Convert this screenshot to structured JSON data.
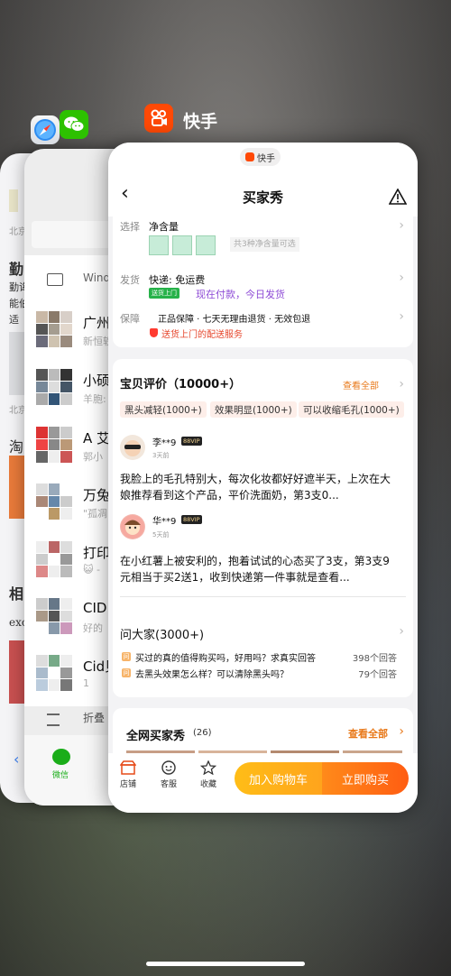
{
  "switcher": {
    "kuaishou_label": "快手"
  },
  "safari_card": {
    "lines": [
      "北京",
      "勤",
      "勤诲",
      "能伯",
      "适",
      "北京",
      "淘",
      "相",
      "exc"
    ],
    "bottom_icon": "chevron-left"
  },
  "wechat_card": {
    "header_row": "Wind",
    "rows": [
      {
        "title": "广州",
        "sub": "新恒轶"
      },
      {
        "title": "小硕",
        "sub": "羊胞:"
      },
      {
        "title": "A 艾",
        "sub": "郭小"
      },
      {
        "title": "万兔",
        "sub": "\"孤凋"
      },
      {
        "title": "打印",
        "sub": "😺 -"
      },
      {
        "title": "CID",
        "sub": "好的"
      },
      {
        "title": "Cid贝",
        "sub": "1"
      }
    ],
    "folded_label": "折叠",
    "tab_label": "微信"
  },
  "kuaishou": {
    "top_badge": "快手",
    "page_title": "买家秀",
    "spec": {
      "select_label": "选择",
      "select_value": "净含量",
      "select_hint": "共3种净含量可选",
      "ship_label": "发货",
      "ship_value": "快递: 免运费",
      "ship_badge": "送货上门",
      "ship_note": "现在付款，今日发货",
      "guarantee_label": "保障",
      "guarantee_value": "正品保障 · 七天无理由退货 · 无效包退",
      "guarantee_note": "送货上门的配送服务"
    },
    "reviews": {
      "title": "宝贝评价（10000+）",
      "view_all": "查看全部",
      "tags": [
        "黑头减轻(1000+)",
        "效果明显(1000+)",
        "可以收缩毛孔(1000+)"
      ],
      "items": [
        {
          "user": "李**9",
          "vip": "88VIP",
          "time": "3天前",
          "text": "我脸上的毛孔特别大，每次化妆都好好遮半天，上次在大娘推荐看到这个产品，平价洗面奶，第3支0..."
        },
        {
          "user": "华**9",
          "vip": "88VIP",
          "time": "5天前",
          "text": "在小红薯上被安利的，抱着试试的心态买了3支，第3支9元相当于买2送1，收到快递第一件事就是查看..."
        }
      ]
    },
    "qa": {
      "title": "问大家(3000+)",
      "items": [
        {
          "q": "买过的真的值得购买吗，好用吗？求真实回答",
          "count": "398个回答"
        },
        {
          "q": "去黑头效果怎么样？可以清除黑头吗？",
          "count": "79个回答"
        }
      ]
    },
    "buyer_show": {
      "title": "全网买家秀",
      "count": "(26)",
      "view_all": "查看全部"
    },
    "bottom_bar": {
      "shop": "店铺",
      "service": "客服",
      "favorite": "收藏",
      "add_cart": "加入购物车",
      "buy_now": "立即购买"
    }
  }
}
